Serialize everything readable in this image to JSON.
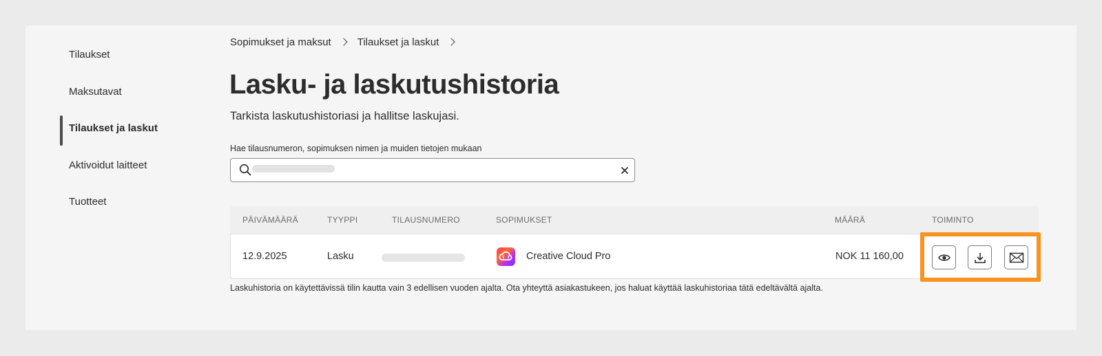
{
  "sidebar": {
    "items": [
      {
        "label": "Tilaukset"
      },
      {
        "label": "Maksutavat"
      },
      {
        "label": "Tilaukset ja laskut"
      },
      {
        "label": "Aktivoidut laitteet"
      },
      {
        "label": "Tuotteet"
      }
    ],
    "active_index": 2
  },
  "breadcrumb": {
    "items": [
      {
        "label": "Sopimukset ja maksut"
      },
      {
        "label": "Tilaukset ja laskut"
      }
    ]
  },
  "header": {
    "title": "Lasku- ja laskutushistoria",
    "subtitle": "Tarkista laskutushistoriasi ja hallitse laskujasi."
  },
  "search": {
    "label": "Hae tilausnumeron, sopimuksen nimen ja muiden tietojen mukaan",
    "value": ""
  },
  "table": {
    "columns": [
      "PÄIVÄMÄÄRÄ",
      "TYYPPI",
      "TILAUSNUMERO",
      "SOPIMUKSET",
      "MÄÄRÄ",
      "TOIMINTO"
    ],
    "rows": [
      {
        "date": "12.9.2025",
        "type": "Lasku",
        "order_number": "",
        "plan": "Creative Cloud Pro",
        "plan_icon": "creative-cloud-icon",
        "amount": "NOK 11 160,00",
        "actions": [
          "view-icon",
          "download-icon",
          "email-icon"
        ]
      }
    ]
  },
  "footnote": "Laskuhistoria on käytettävissä tilin kautta vain 3 edellisen vuoden ajalta. Ota yhteyttä asiakastukeen, jos haluat käyttää laskuhistoriaa tätä edeltävältä ajalta.",
  "colors": {
    "highlight": "#f7931e",
    "background": "#ebebeb",
    "panel": "#f5f5f5"
  }
}
